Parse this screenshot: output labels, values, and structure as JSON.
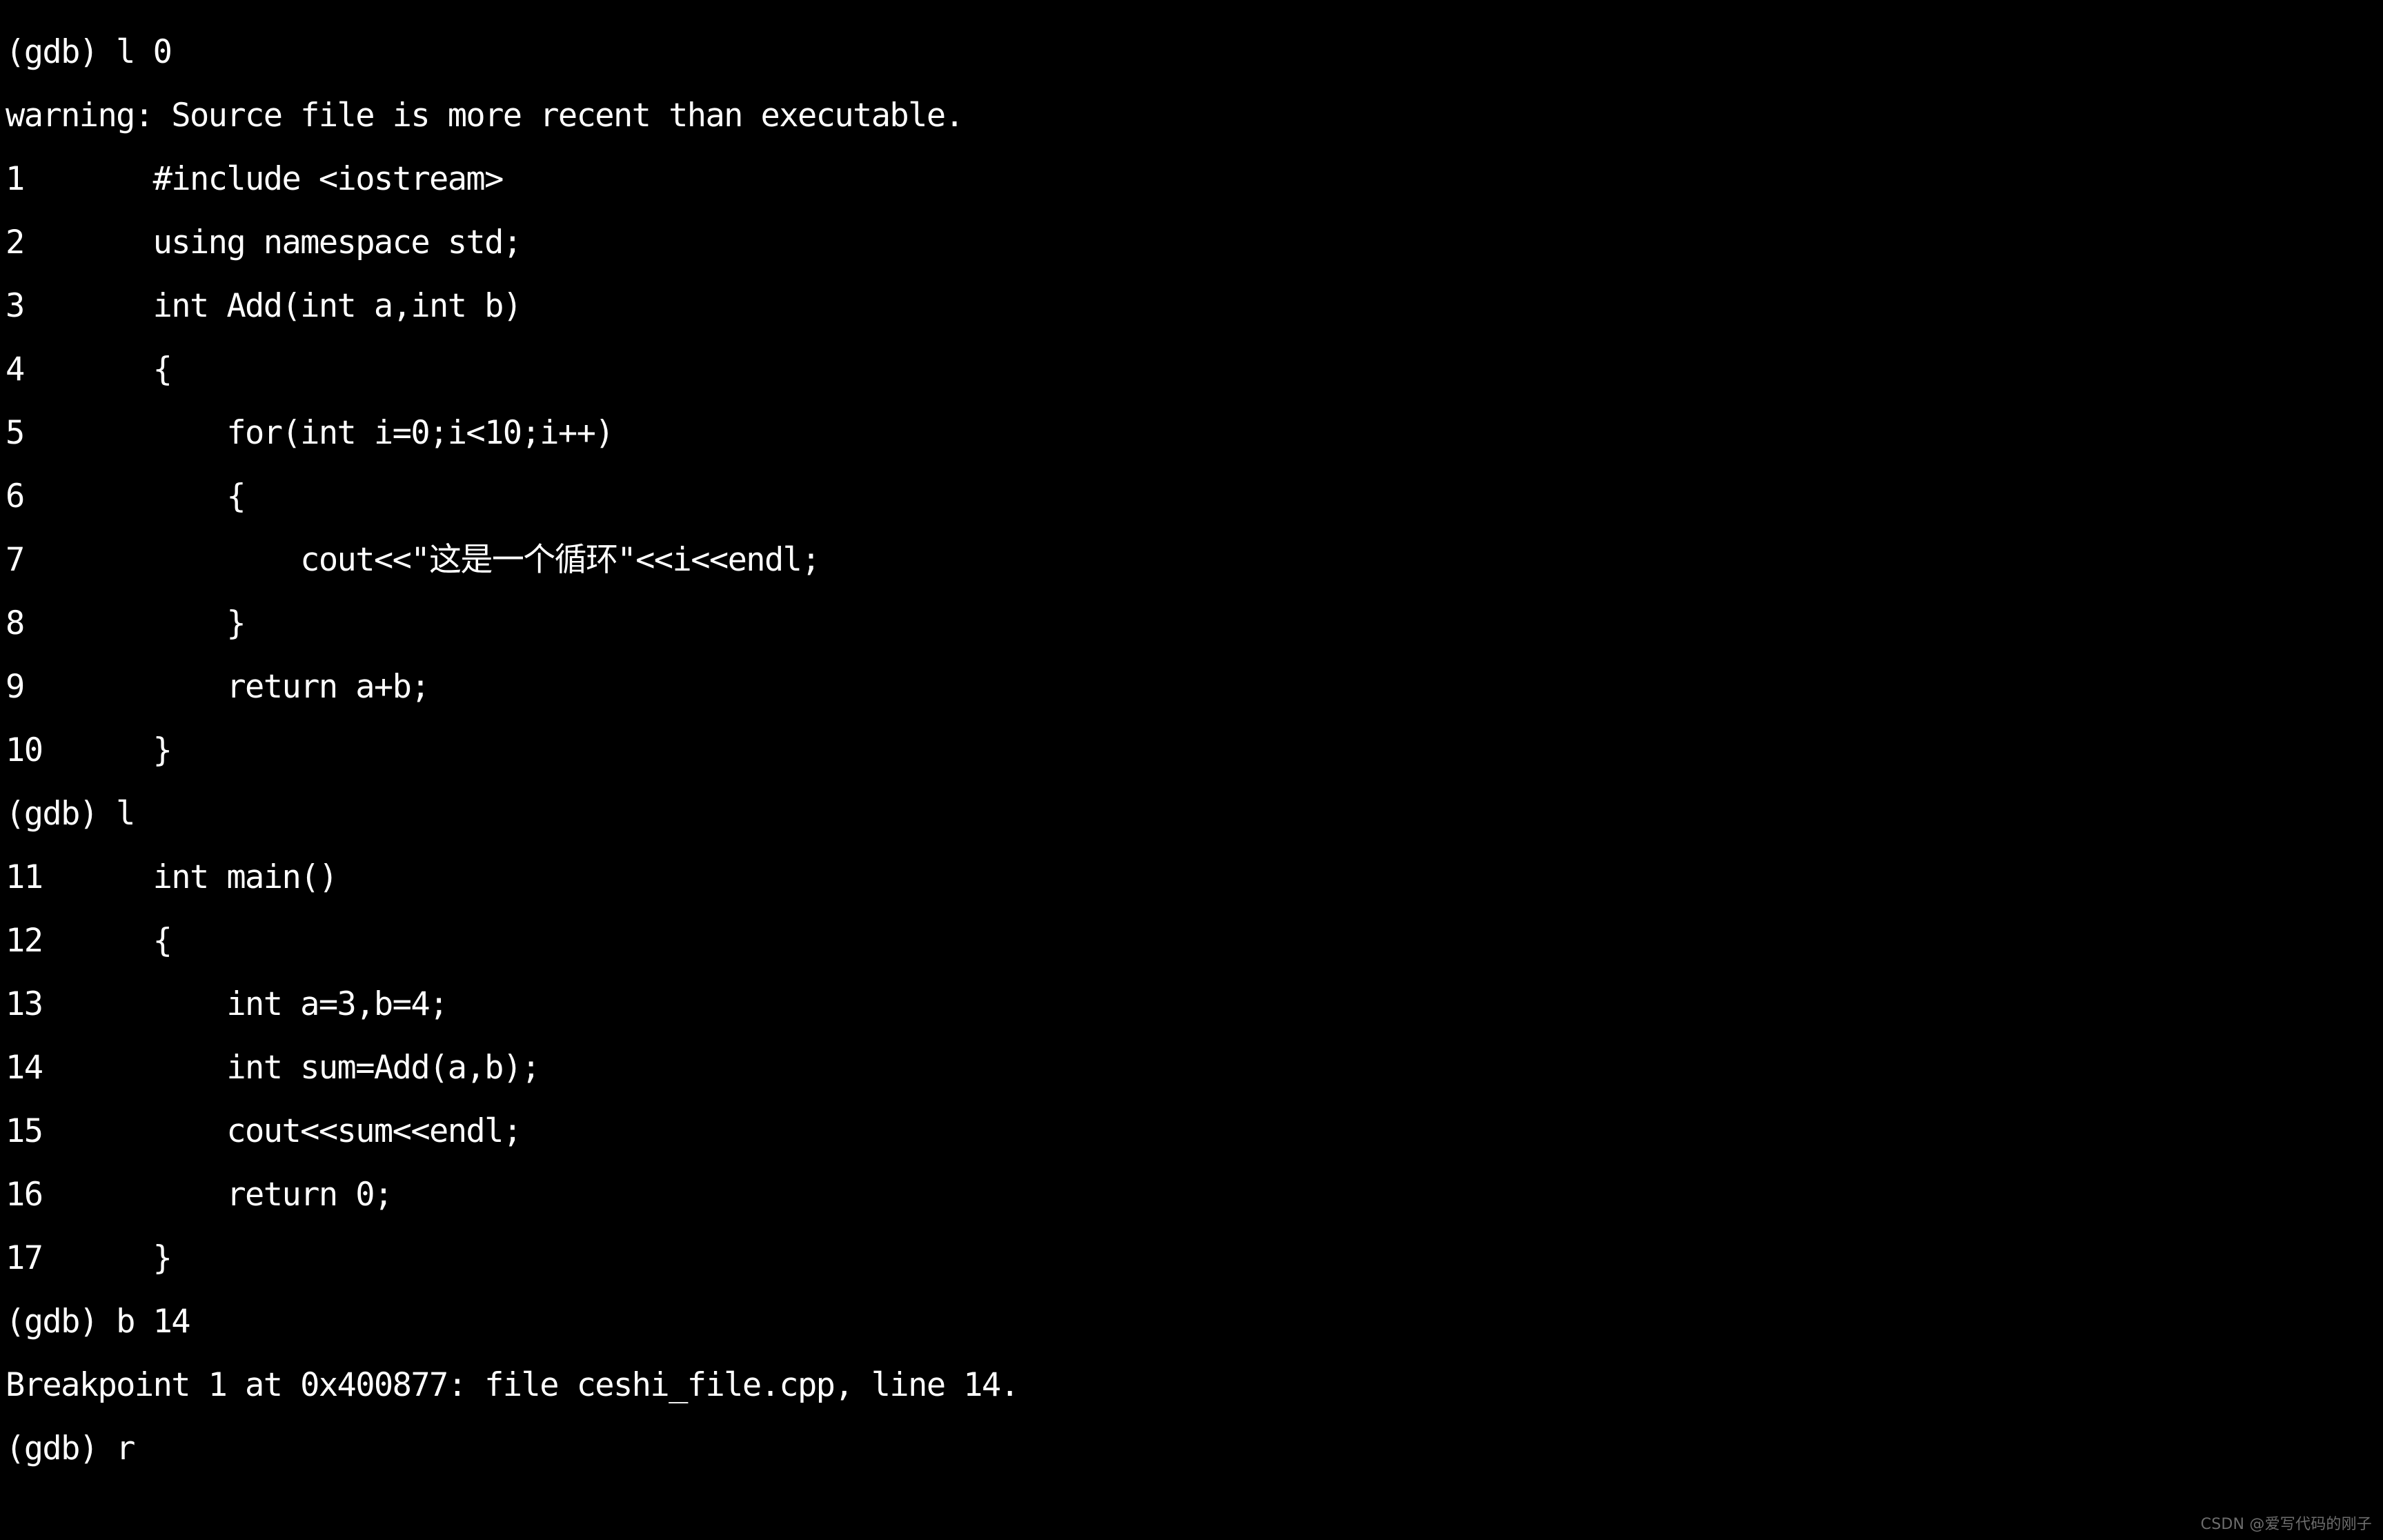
{
  "terminal": {
    "background_color": "#000000",
    "foreground_color": "#ffffff",
    "prompt": "(gdb)",
    "source_file": "ceshi_file.cpp",
    "breakpoint_address": "0x400877",
    "breakpoint_line": "14",
    "lines": [
      {
        "id": "cmd-list-0",
        "text": "(gdb) l 0"
      },
      {
        "id": "warning",
        "text": "warning: Source file is more recent than executable."
      },
      {
        "id": "src-1",
        "text": "1\t#include <iostream>"
      },
      {
        "id": "src-2",
        "text": "2\tusing namespace std;"
      },
      {
        "id": "src-3",
        "text": "3\tint Add(int a,int b)"
      },
      {
        "id": "src-4",
        "text": "4\t{"
      },
      {
        "id": "src-5",
        "text": "5\t    for(int i=0;i<10;i++)"
      },
      {
        "id": "src-6",
        "text": "6\t    {"
      },
      {
        "id": "src-7",
        "text": "7\t        cout<<\"这是一个循环\"<<i<<endl;"
      },
      {
        "id": "src-8",
        "text": "8\t    }"
      },
      {
        "id": "src-9",
        "text": "9\t    return a+b;"
      },
      {
        "id": "src-10",
        "text": "10\t}"
      },
      {
        "id": "cmd-list",
        "text": "(gdb) l"
      },
      {
        "id": "src-11",
        "text": "11\tint main()"
      },
      {
        "id": "src-12",
        "text": "12\t{"
      },
      {
        "id": "src-13",
        "text": "13\t    int a=3,b=4;"
      },
      {
        "id": "src-14",
        "text": "14\t    int sum=Add(a,b);"
      },
      {
        "id": "src-15",
        "text": "15\t    cout<<sum<<endl;"
      },
      {
        "id": "src-16",
        "text": "16\t    return 0;"
      },
      {
        "id": "src-17",
        "text": "17\t}"
      },
      {
        "id": "cmd-break-14",
        "text": "(gdb) b 14"
      },
      {
        "id": "breakpoint-result",
        "text": "Breakpoint 1 at 0x400877: file ceshi_file.cpp, line 14."
      },
      {
        "id": "cmd-run",
        "text": "(gdb) r"
      }
    ]
  },
  "watermark": {
    "text": "CSDN @爱写代码的刚子",
    "color": "#8c8c8c"
  },
  "source_code": {
    "file": "ceshi_file.cpp",
    "numbered_lines": [
      {
        "number": "1",
        "code": "#include <iostream>"
      },
      {
        "number": "2",
        "code": "using namespace std;"
      },
      {
        "number": "3",
        "code": "int Add(int a,int b)"
      },
      {
        "number": "4",
        "code": "{"
      },
      {
        "number": "5",
        "code": "    for(int i=0;i<10;i++)"
      },
      {
        "number": "6",
        "code": "    {"
      },
      {
        "number": "7",
        "code": "        cout<<\"这是一个循环\"<<i<<endl;"
      },
      {
        "number": "8",
        "code": "    }"
      },
      {
        "number": "9",
        "code": "    return a+b;"
      },
      {
        "number": "10",
        "code": "}"
      },
      {
        "number": "11",
        "code": "int main()"
      },
      {
        "number": "12",
        "code": "{"
      },
      {
        "number": "13",
        "code": "    int a=3,b=4;"
      },
      {
        "number": "14",
        "code": "    int sum=Add(a,b);"
      },
      {
        "number": "15",
        "code": "    cout<<sum<<endl;"
      },
      {
        "number": "16",
        "code": "    return 0;"
      },
      {
        "number": "17",
        "code": "}"
      }
    ]
  },
  "commands_entered": [
    "l 0",
    "l",
    "b 14",
    "r"
  ]
}
